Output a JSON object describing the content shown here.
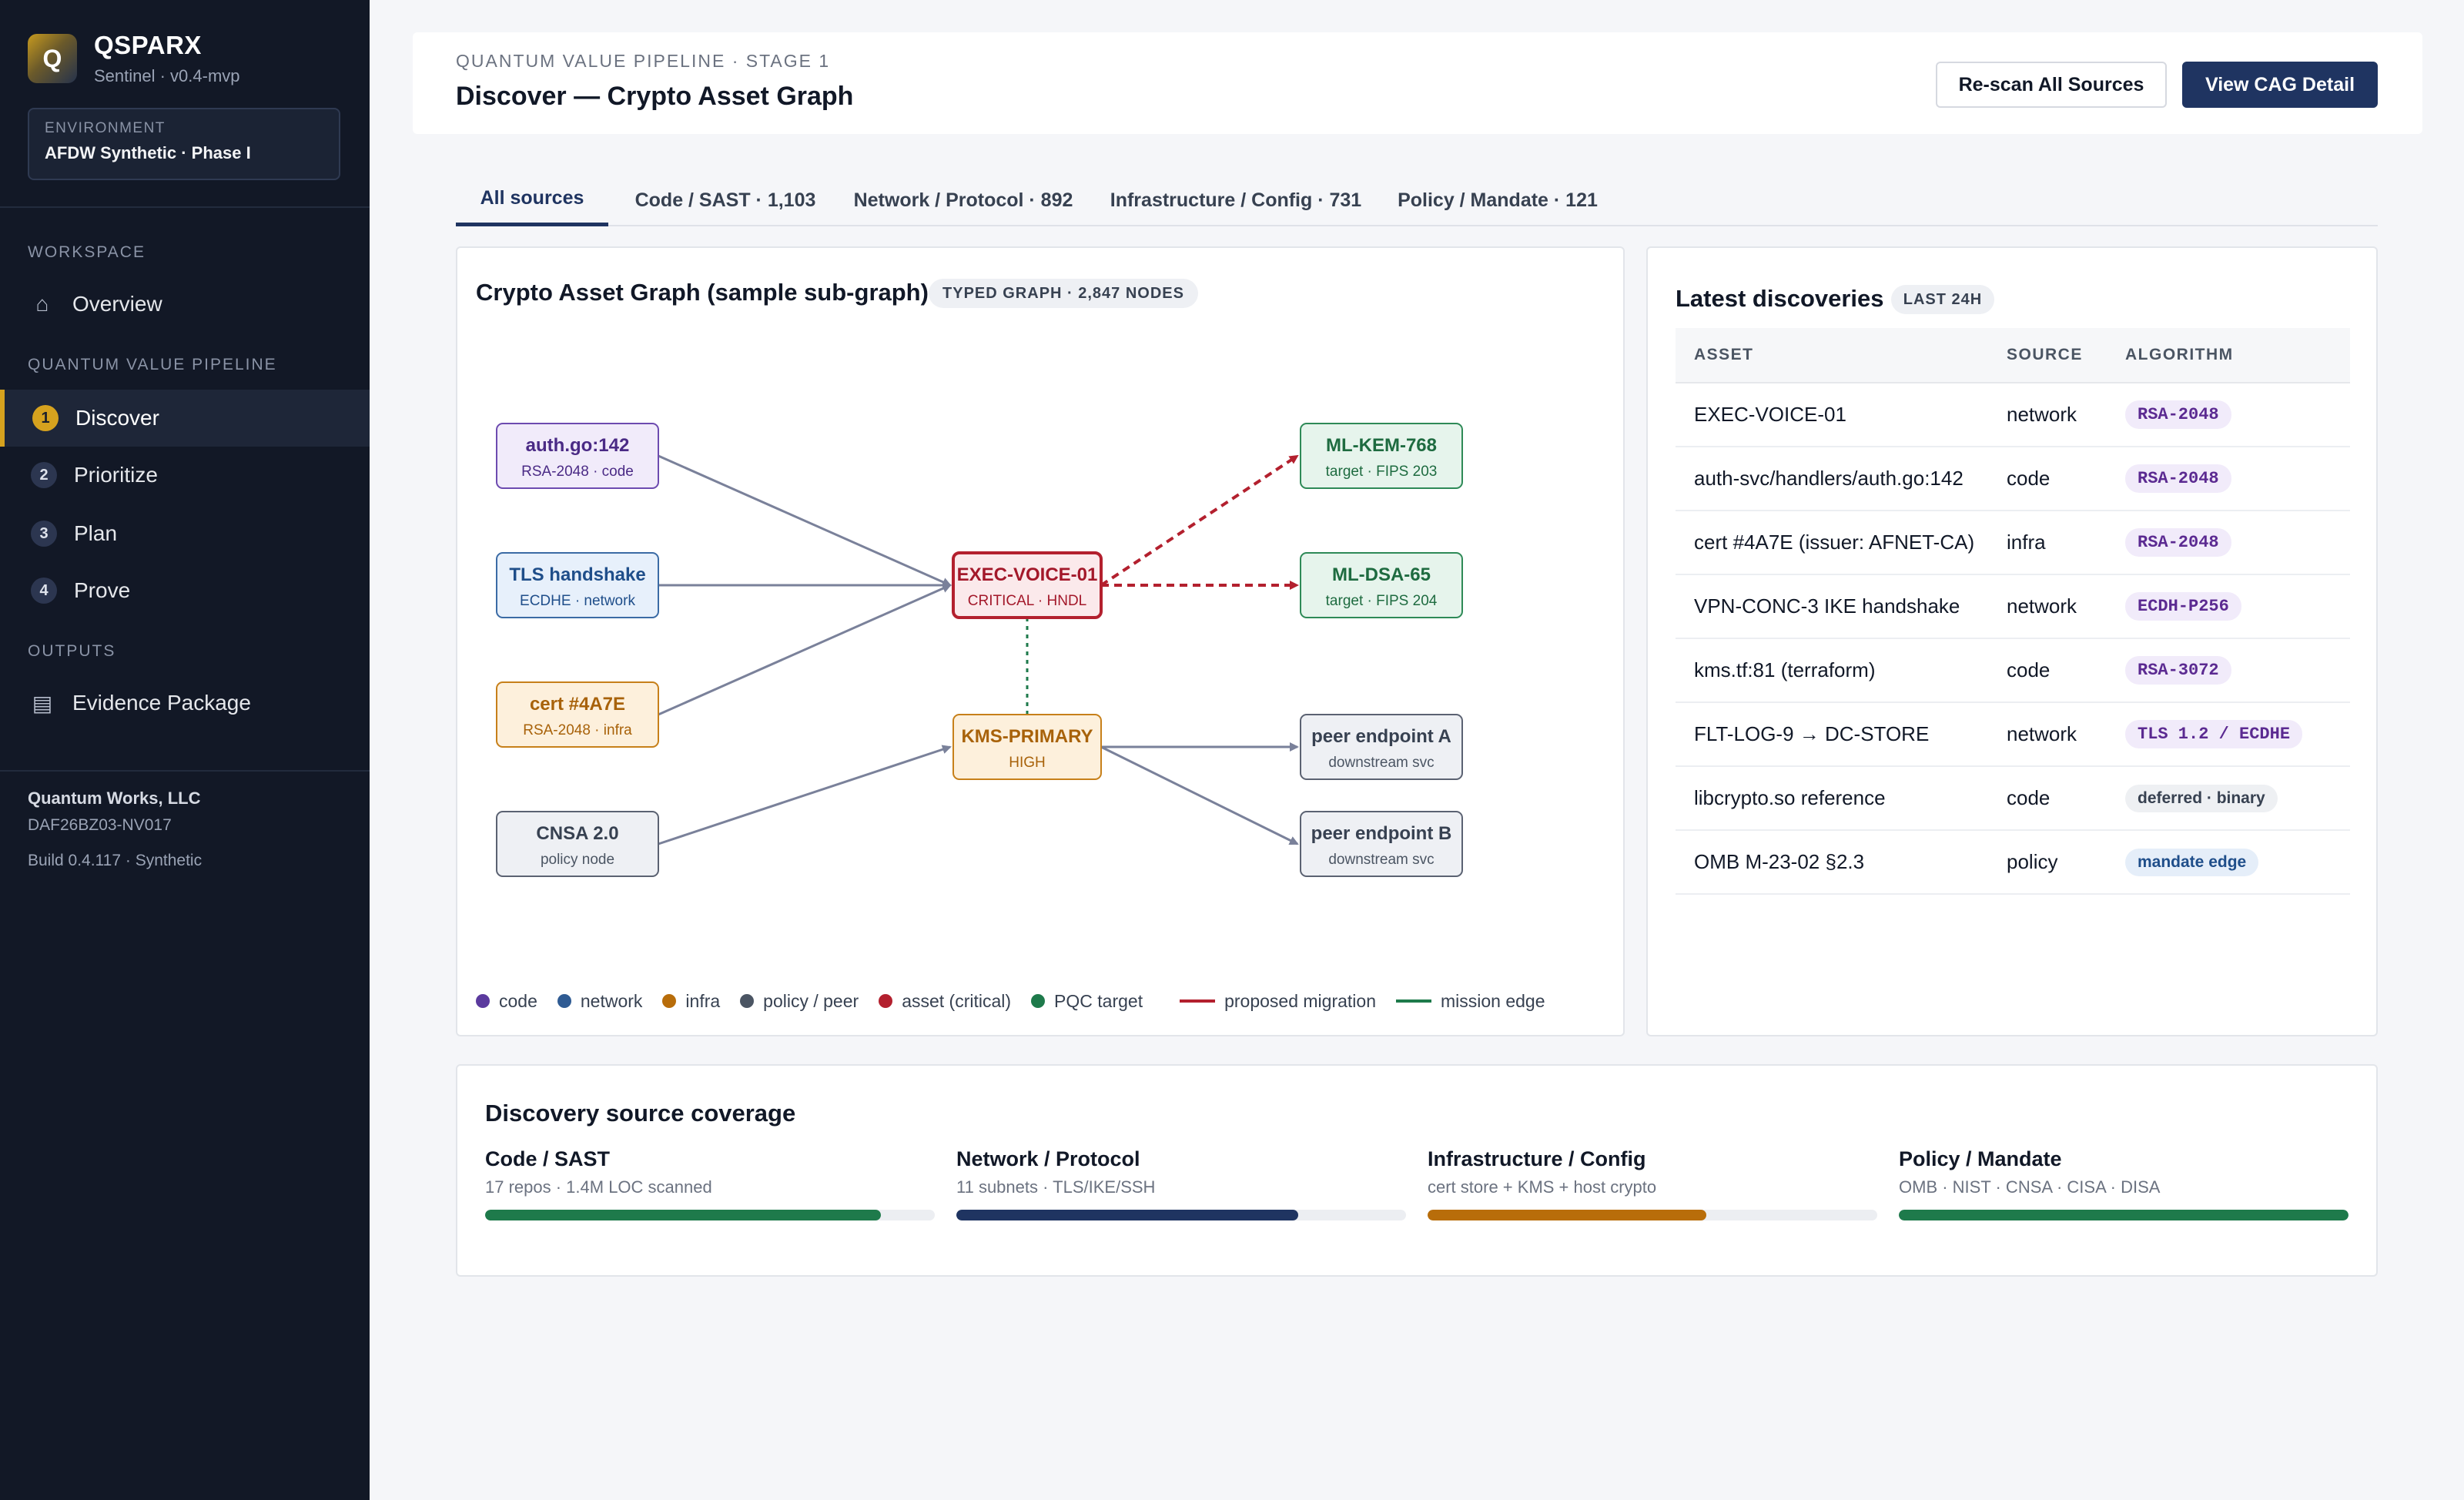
{
  "brand": {
    "logo_letter": "Q",
    "name": "QSPARX",
    "subtitle": "Sentinel · v0.4-mvp"
  },
  "environment": {
    "label": "ENVIRONMENT",
    "value": "AFDW Synthetic · Phase I"
  },
  "sidebar": {
    "workspace_label": "WORKSPACE",
    "overview": {
      "label": "Overview",
      "icon": "home-icon"
    },
    "pipeline_label": "QUANTUM VALUE PIPELINE",
    "pipeline_items": [
      {
        "step": "1",
        "label": "Discover",
        "active": true
      },
      {
        "step": "2",
        "label": "Prioritize",
        "active": false
      },
      {
        "step": "3",
        "label": "Plan",
        "active": false
      },
      {
        "step": "4",
        "label": "Prove",
        "active": false
      }
    ],
    "outputs_label": "OUTPUTS",
    "evidence": {
      "label": "Evidence Package",
      "icon": "document-icon"
    },
    "org_name": "Quantum Works, LLC",
    "org_id": "DAF26BZ03-NV017",
    "build": "Build 0.4.117 · Synthetic"
  },
  "header": {
    "breadcrumb": "QUANTUM VALUE PIPELINE · STAGE 1",
    "title": "Discover — Crypto Asset Graph",
    "rescan_label": "Re-scan All Sources",
    "view_label": "View CAG Detail"
  },
  "tabs": [
    {
      "label": "All sources",
      "active": true
    },
    {
      "label": "Code / SAST · 1,103",
      "active": false
    },
    {
      "label": "Network / Protocol · 892",
      "active": false
    },
    {
      "label": "Infrastructure / Config · 731",
      "active": false
    },
    {
      "label": "Policy / Mandate · 121",
      "active": false
    }
  ],
  "graph": {
    "title": "Crypto Asset Graph (sample sub-graph)",
    "badge": "TYPED GRAPH · 2,847 NODES",
    "nodes": [
      {
        "id": "auth",
        "label": "auth.go:142",
        "sub": "RSA-2048 · code",
        "kind": "code"
      },
      {
        "id": "tls",
        "label": "TLS handshake",
        "sub": "ECDHE · network",
        "kind": "network"
      },
      {
        "id": "cert",
        "label": "cert #4A7E",
        "sub": "RSA-2048 · infra",
        "kind": "infra"
      },
      {
        "id": "cnsa",
        "label": "CNSA 2.0",
        "sub": "policy node",
        "kind": "policy"
      },
      {
        "id": "exec",
        "label": "EXEC-VOICE-01",
        "sub": "CRITICAL · HNDL",
        "kind": "critical"
      },
      {
        "id": "kms",
        "label": "KMS-PRIMARY",
        "sub": "HIGH",
        "kind": "high"
      },
      {
        "id": "kem",
        "label": "ML-KEM-768",
        "sub": "target · FIPS 203",
        "kind": "pqc"
      },
      {
        "id": "dsa",
        "label": "ML-DSA-65",
        "sub": "target · FIPS 204",
        "kind": "pqc"
      },
      {
        "id": "peerA",
        "label": "peer endpoint A",
        "sub": "downstream svc",
        "kind": "policy"
      },
      {
        "id": "peerB",
        "label": "peer endpoint B",
        "sub": "downstream svc",
        "kind": "policy"
      }
    ],
    "edges": [
      {
        "from": "auth",
        "to": "exec",
        "type": "normal"
      },
      {
        "from": "tls",
        "to": "exec",
        "type": "normal"
      },
      {
        "from": "cert",
        "to": "exec",
        "type": "normal"
      },
      {
        "from": "cnsa",
        "to": "kms",
        "type": "normal"
      },
      {
        "from": "exec",
        "to": "kem",
        "type": "migration"
      },
      {
        "from": "exec",
        "to": "dsa",
        "type": "migration"
      },
      {
        "from": "exec",
        "to": "kms",
        "type": "mission"
      },
      {
        "from": "kms",
        "to": "peerA",
        "type": "normal"
      },
      {
        "from": "kms",
        "to": "peerB",
        "type": "normal"
      }
    ],
    "legend": [
      {
        "label": "code",
        "color": "#5b3a9e",
        "shape": "dot"
      },
      {
        "label": "network",
        "color": "#2f5b93",
        "shape": "dot"
      },
      {
        "label": "infra",
        "color": "#b86d0a",
        "shape": "dot"
      },
      {
        "label": "policy / peer",
        "color": "#4b5563",
        "shape": "dot"
      },
      {
        "label": "asset (critical)",
        "color": "#b3202e",
        "shape": "dot"
      },
      {
        "label": "PQC target",
        "color": "#1e7a4b",
        "shape": "dot"
      },
      {
        "label": "proposed migration",
        "color": "#b3202e",
        "shape": "line"
      },
      {
        "label": "mission edge",
        "color": "#1e7a4b",
        "shape": "line"
      }
    ]
  },
  "discoveries": {
    "title": "Latest discoveries",
    "badge": "LAST 24H",
    "headers": [
      "ASSET",
      "SOURCE",
      "ALGORITHM"
    ],
    "rows": [
      {
        "asset": "EXEC-VOICE-01",
        "source": "network",
        "algorithm": "RSA-2048",
        "style": "mono"
      },
      {
        "asset": "auth-svc/handlers/auth.go:142",
        "source": "code",
        "algorithm": "RSA-2048",
        "style": "mono"
      },
      {
        "asset": "cert #4A7E (issuer: AFNET-CA)",
        "source": "infra",
        "algorithm": "RSA-2048",
        "style": "mono"
      },
      {
        "asset": "VPN-CONC-3 IKE handshake",
        "source": "network",
        "algorithm": "ECDH-P256",
        "style": "mono"
      },
      {
        "asset": "kms.tf:81 (terraform)",
        "source": "code",
        "algorithm": "RSA-3072",
        "style": "mono"
      },
      {
        "asset": "FLT-LOG-9 → DC-STORE",
        "source": "network",
        "algorithm": "TLS 1.2 / ECDHE",
        "style": "mono"
      },
      {
        "asset": "libcrypto.so reference",
        "source": "code",
        "algorithm": "deferred · binary",
        "style": "grey"
      },
      {
        "asset": "OMB M-23-02 §2.3",
        "source": "policy",
        "algorithm": "mandate edge",
        "style": "blue"
      }
    ]
  },
  "coverage": {
    "title": "Discovery source coverage",
    "items": [
      {
        "name": "Code / SAST",
        "desc": "17 repos · 1.4M LOC scanned",
        "fraction": 0.88,
        "color": "#1e7a4b"
      },
      {
        "name": "Network / Protocol",
        "desc": "11 subnets · TLS/IKE/SSH",
        "fraction": 0.76,
        "color": "#1f3461"
      },
      {
        "name": "Infrastructure / Config",
        "desc": "cert store + KMS + host crypto",
        "fraction": 0.62,
        "color": "#b86d0a"
      },
      {
        "name": "Policy / Mandate",
        "desc": "OMB · NIST · CNSA · CISA · DISA",
        "fraction": 1.0,
        "color": "#1e7a4b"
      }
    ]
  }
}
